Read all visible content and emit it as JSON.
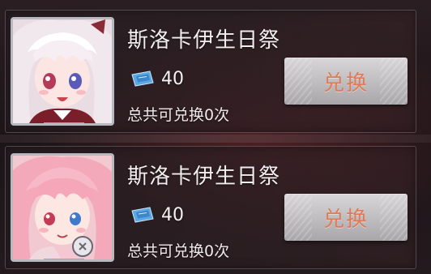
{
  "colors": {
    "button_text": "#e07a55",
    "frame_accent": "#49c5ef",
    "ticket": "#5aa8e6"
  },
  "items": [
    {
      "name": "斯洛卡伊生日祭",
      "cost": "40",
      "currency_icon": "ticket-icon",
      "limit_text": "总共可兑换0次",
      "button_label": "兑换",
      "portrait": "white-haired-character-portrait"
    },
    {
      "name": "斯洛卡伊生日祭",
      "cost": "40",
      "currency_icon": "ticket-icon",
      "limit_text": "总共可兑换0次",
      "button_label": "兑换",
      "portrait": "pink-haired-character-portrait"
    }
  ]
}
